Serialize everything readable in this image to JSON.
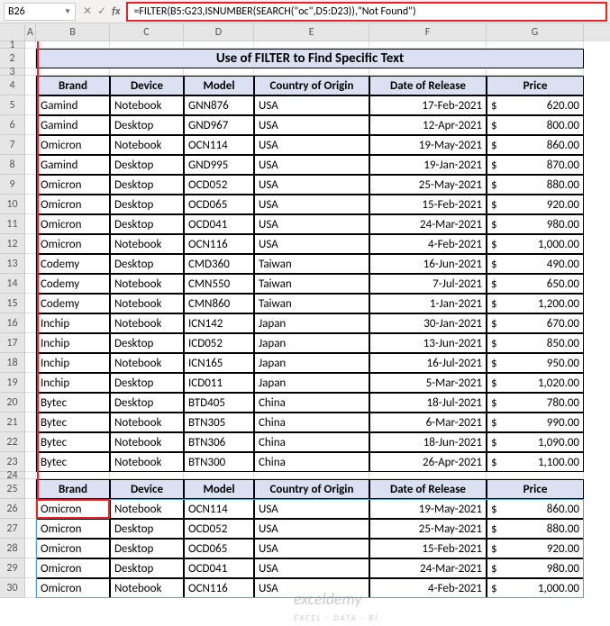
{
  "nameBox": "B26",
  "formula": "=FILTER(B5:G23,ISNUMBER(SEARCH(\"oc\",D5:D23)),\"Not Found\")",
  "columns": [
    "A",
    "B",
    "C",
    "D",
    "E",
    "F",
    "G"
  ],
  "title": "Use of FILTER to Find Specific Text",
  "headers": {
    "brand": "Brand",
    "device": "Device",
    "model": "Model",
    "country": "Country of Origin",
    "date": "Date of Release",
    "price": "Price"
  },
  "currency": "$",
  "rows": [
    {
      "brand": "Gamind",
      "device": "Notebook",
      "model": "GNN876",
      "country": "USA",
      "date": "17-Feb-2021",
      "price": "620.00"
    },
    {
      "brand": "Gamind",
      "device": "Desktop",
      "model": "GND967",
      "country": "USA",
      "date": "12-Apr-2021",
      "price": "800.00"
    },
    {
      "brand": "Omicron",
      "device": "Notebook",
      "model": "OCN114",
      "country": "USA",
      "date": "19-May-2021",
      "price": "860.00"
    },
    {
      "brand": "Gamind",
      "device": "Desktop",
      "model": "GND995",
      "country": "USA",
      "date": "19-Jan-2021",
      "price": "870.00"
    },
    {
      "brand": "Omicron",
      "device": "Desktop",
      "model": "OCD052",
      "country": "USA",
      "date": "25-May-2021",
      "price": "880.00"
    },
    {
      "brand": "Omicron",
      "device": "Desktop",
      "model": "OCD065",
      "country": "USA",
      "date": "15-Feb-2021",
      "price": "920.00"
    },
    {
      "brand": "Omicron",
      "device": "Desktop",
      "model": "OCD041",
      "country": "USA",
      "date": "24-Mar-2021",
      "price": "980.00"
    },
    {
      "brand": "Omicron",
      "device": "Notebook",
      "model": "OCN116",
      "country": "USA",
      "date": "4-Feb-2021",
      "price": "1,000.00"
    },
    {
      "brand": "Codemy",
      "device": "Desktop",
      "model": "CMD360",
      "country": "Taiwan",
      "date": "16-Jun-2021",
      "price": "490.00"
    },
    {
      "brand": "Codemy",
      "device": "Notebook",
      "model": "CMN550",
      "country": "Taiwan",
      "date": "7-Jul-2021",
      "price": "650.00"
    },
    {
      "brand": "Codemy",
      "device": "Notebook",
      "model": "CMN860",
      "country": "Taiwan",
      "date": "1-Jan-2021",
      "price": "1,200.00"
    },
    {
      "brand": "Inchip",
      "device": "Notebook",
      "model": "ICN142",
      "country": "Japan",
      "date": "30-Jan-2021",
      "price": "670.00"
    },
    {
      "brand": "Inchip",
      "device": "Desktop",
      "model": "ICD052",
      "country": "Japan",
      "date": "13-Jun-2021",
      "price": "850.00"
    },
    {
      "brand": "Inchip",
      "device": "Notebook",
      "model": "ICN165",
      "country": "Japan",
      "date": "16-Jul-2021",
      "price": "950.00"
    },
    {
      "brand": "Inchip",
      "device": "Desktop",
      "model": "ICD011",
      "country": "Japan",
      "date": "5-Mar-2021",
      "price": "1,020.00"
    },
    {
      "brand": "Bytec",
      "device": "Desktop",
      "model": "BTD405",
      "country": "China",
      "date": "18-Jul-2021",
      "price": "780.00"
    },
    {
      "brand": "Bytec",
      "device": "Notebook",
      "model": "BTN305",
      "country": "China",
      "date": "6-Mar-2021",
      "price": "990.00"
    },
    {
      "brand": "Bytec",
      "device": "Notebook",
      "model": "BTN306",
      "country": "China",
      "date": "18-Jun-2021",
      "price": "1,090.00"
    },
    {
      "brand": "Bytec",
      "device": "Notebook",
      "model": "BTN300",
      "country": "China",
      "date": "26-Apr-2021",
      "price": "1,100.00"
    }
  ],
  "resultRows": [
    {
      "brand": "Omicron",
      "device": "Notebook",
      "model": "OCN114",
      "country": "USA",
      "date": "19-May-2021",
      "price": "860.00"
    },
    {
      "brand": "Omicron",
      "device": "Desktop",
      "model": "OCD052",
      "country": "USA",
      "date": "25-May-2021",
      "price": "880.00"
    },
    {
      "brand": "Omicron",
      "device": "Desktop",
      "model": "OCD065",
      "country": "USA",
      "date": "15-Feb-2021",
      "price": "920.00"
    },
    {
      "brand": "Omicron",
      "device": "Desktop",
      "model": "OCD041",
      "country": "USA",
      "date": "24-Mar-2021",
      "price": "980.00"
    },
    {
      "brand": "Omicron",
      "device": "Notebook",
      "model": "OCN116",
      "country": "USA",
      "date": "4-Feb-2021",
      "price": "1,000.00"
    }
  ],
  "watermark": "exceldemy",
  "watermarkSub": "EXCEL · DATA · BI"
}
